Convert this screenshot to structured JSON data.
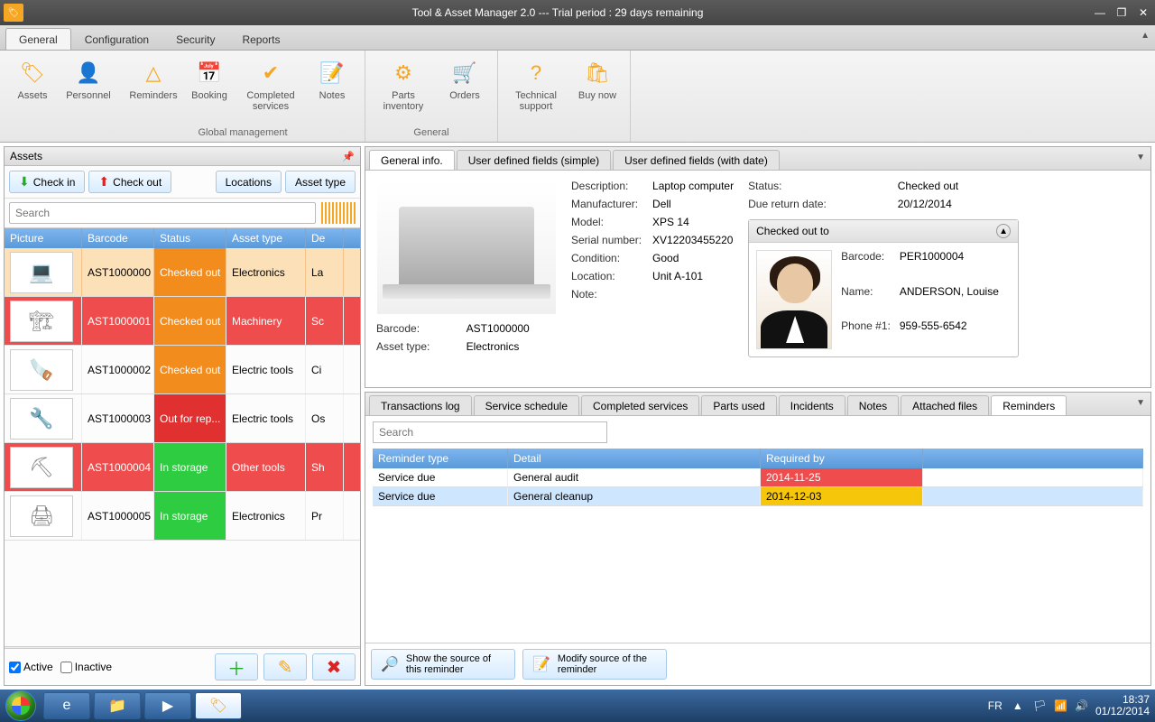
{
  "window": {
    "title": "Tool & Asset Manager 2.0 --- Trial period : 29 days remaining"
  },
  "ribbonTabs": {
    "general": "General",
    "configuration": "Configuration",
    "security": "Security",
    "reports": "Reports"
  },
  "ribbon": {
    "assets": "Assets",
    "personnel": "Personnel",
    "reminders": "Reminders",
    "booking": "Booking",
    "completed": "Completed services",
    "notes": "Notes",
    "parts": "Parts inventory",
    "orders": "Orders",
    "support": "Technical support",
    "buy": "Buy now",
    "grp_global": "Global management",
    "grp_general": "General"
  },
  "assetsPanel": {
    "title": "Assets",
    "checkin": "Check in",
    "checkout": "Check out",
    "locations": "Locations",
    "assetType": "Asset type",
    "searchPlaceholder": "Search",
    "columns": {
      "picture": "Picture",
      "barcode": "Barcode",
      "status": "Status",
      "assetType": "Asset type",
      "desc": "De"
    },
    "rows": [
      {
        "barcode": "AST1000000",
        "status": "Checked out",
        "statusClass": "status-checkedout",
        "atype": "Electronics",
        "desc": "La",
        "rowClass": "row-sel",
        "thumb": "💻"
      },
      {
        "barcode": "AST1000001",
        "status": "Checked out",
        "statusClass": "status-checkedout",
        "atype": "Machinery",
        "desc": "Sc",
        "rowClass": "row-red",
        "thumb": "🏗"
      },
      {
        "barcode": "AST1000002",
        "status": "Checked out",
        "statusClass": "status-checkedout",
        "atype": "Electric tools",
        "desc": "Ci",
        "rowClass": "",
        "thumb": "🪚"
      },
      {
        "barcode": "AST1000003",
        "status": "Out for rep...",
        "statusClass": "status-outrepair",
        "atype": "Electric tools",
        "desc": "Os",
        "rowClass": "",
        "thumb": "🔧"
      },
      {
        "barcode": "AST1000004",
        "status": "In storage",
        "statusClass": "status-instorage",
        "atype": "Other tools",
        "desc": "Sh",
        "rowClass": "row-red",
        "thumb": "⛏"
      },
      {
        "barcode": "AST1000005",
        "status": "In storage",
        "statusClass": "status-instorage",
        "atype": "Electronics",
        "desc": "Pr",
        "rowClass": "",
        "thumb": "🖨"
      }
    ],
    "active": "Active",
    "inactive": "Inactive"
  },
  "detailTabs": {
    "general": "General info.",
    "udf": "User defined fields (simple)",
    "udfd": "User defined fields (with date)"
  },
  "detail": {
    "descLabel": "Description:",
    "desc": "Laptop computer",
    "manuLabel": "Manufacturer:",
    "manu": "Dell",
    "modelLabel": "Model:",
    "model": "XPS 14",
    "serialLabel": "Serial number:",
    "serial": "XV12203455220",
    "condLabel": "Condition:",
    "cond": "Good",
    "locLabel": "Location:",
    "loc": "Unit A-101",
    "noteLabel": "Note:",
    "barcodeLabel": "Barcode:",
    "barcode": "AST1000000",
    "atypeLabel": "Asset type:",
    "atype": "Electronics",
    "statusLabel": "Status:",
    "status": "Checked out",
    "dueLabel": "Due return date:",
    "due": "20/12/2014"
  },
  "checkedOut": {
    "title": "Checked out to",
    "barcodeLabel": "Barcode:",
    "barcode": "PER1000004",
    "nameLabel": "Name:",
    "name": "ANDERSON, Louise",
    "phoneLabel": "Phone #1:",
    "phone": "959-555-6542"
  },
  "subTabs": {
    "trans": "Transactions log",
    "sched": "Service schedule",
    "compl": "Completed services",
    "parts": "Parts used",
    "inc": "Incidents",
    "notes": "Notes",
    "files": "Attached files",
    "rem": "Reminders"
  },
  "reminders": {
    "searchPlaceholder": "Search",
    "col_type": "Reminder type",
    "col_detail": "Detail",
    "col_req": "Required by",
    "rows": [
      {
        "type": "Service due",
        "detail": "General audit",
        "date": "2014-11-25",
        "dateClass": "date-red",
        "rowClass": ""
      },
      {
        "type": "Service due",
        "detail": "General cleanup",
        "date": "2014-12-03",
        "dateClass": "date-yellow",
        "rowClass": "selected"
      }
    ],
    "showSource": "Show the source of this reminder",
    "modifySource": "Modify source of the reminder"
  },
  "taskbar": {
    "lang": "FR",
    "time": "18:37",
    "date": "01/12/2014"
  }
}
